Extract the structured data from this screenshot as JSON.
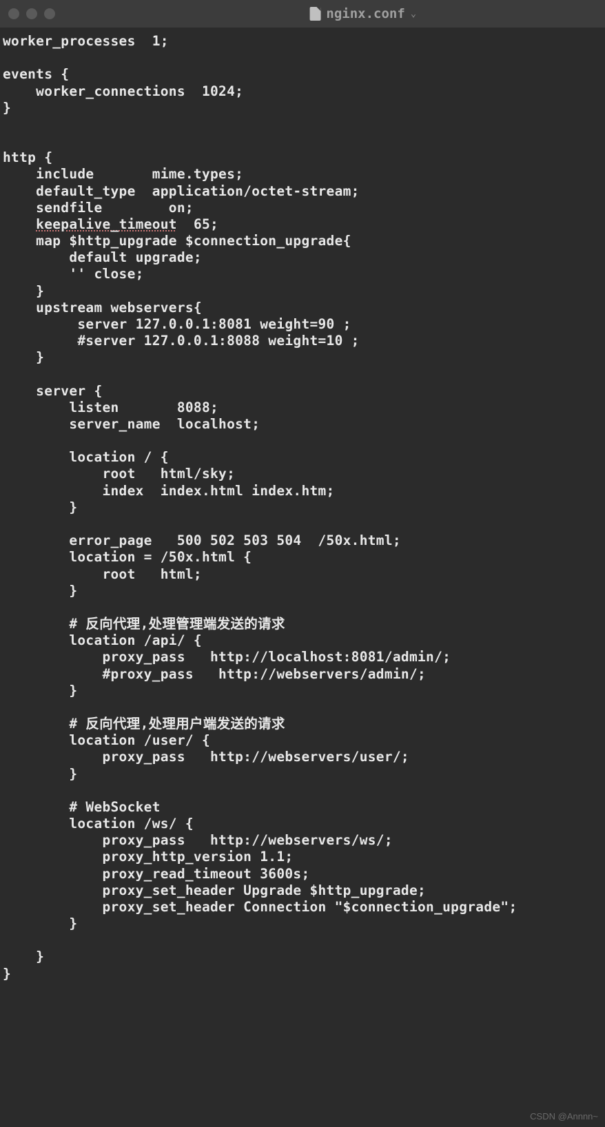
{
  "titlebar": {
    "filename": "nginx.conf"
  },
  "code": {
    "lines": [
      "worker_processes  1;",
      "",
      "events {",
      "    worker_connections  1024;",
      "}",
      "",
      "",
      "http {",
      "    include       mime.types;",
      "    default_type  application/octet-stream;",
      "    sendfile        on;",
      "    ",
      "    map $http_upgrade $connection_upgrade{",
      "        default upgrade;",
      "        '' close;",
      "    }",
      "    upstream webservers{",
      "         server 127.0.0.1:8081 weight=90 ;",
      "         #server 127.0.0.1:8088 weight=10 ;",
      "    }",
      "",
      "    server {",
      "        listen       8088;",
      "        server_name  localhost;",
      "",
      "        location / {",
      "            root   html/sky;",
      "            index  index.html index.htm;",
      "        }",
      "",
      "        error_page   500 502 503 504  /50x.html;",
      "        location = /50x.html {",
      "            root   html;",
      "        }",
      "",
      "        # 反向代理,处理管理端发送的请求",
      "        location /api/ {",
      "            proxy_pass   http://localhost:8081/admin/;",
      "            #proxy_pass   http://webservers/admin/;",
      "        }",
      "",
      "        # 反向代理,处理用户端发送的请求",
      "        location /user/ {",
      "            proxy_pass   http://webservers/user/;",
      "        }",
      "",
      "        # WebSocket",
      "        location /ws/ {",
      "            proxy_pass   http://webservers/ws/;",
      "            proxy_http_version 1.1;",
      "            proxy_read_timeout 3600s;",
      "            proxy_set_header Upgrade $http_upgrade;",
      "            proxy_set_header Connection \"$connection_upgrade\";",
      "        }",
      "",
      "    }",
      "}"
    ],
    "keepalive_line": "keepalive_timeout",
    "keepalive_value": "  65;"
  },
  "watermark": "CSDN @Annnn~"
}
